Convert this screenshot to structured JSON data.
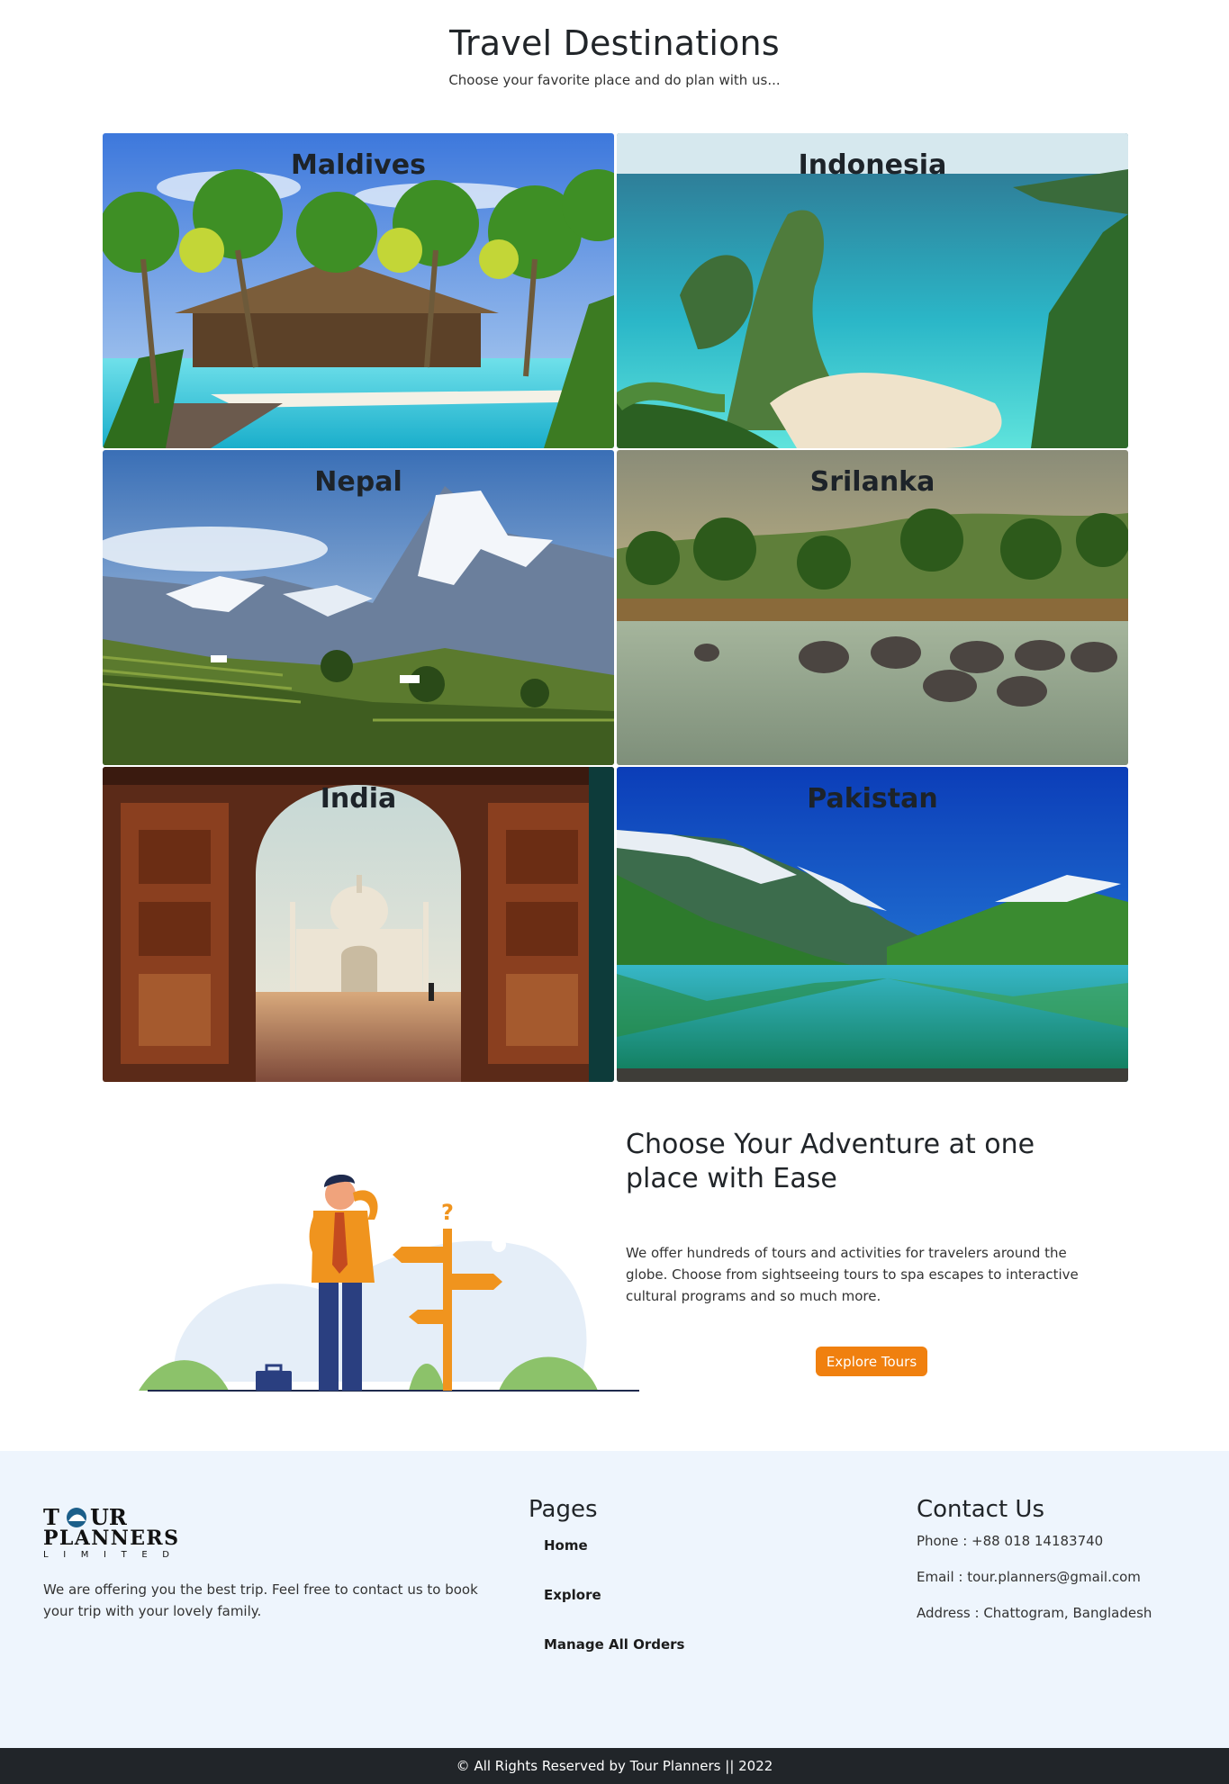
{
  "header": {
    "title": "Travel Destinations",
    "subtitle": "Choose your favorite place and do plan with us..."
  },
  "destinations": [
    {
      "name": "Maldives"
    },
    {
      "name": "Indonesia"
    },
    {
      "name": "Nepal"
    },
    {
      "name": "Srilanka"
    },
    {
      "name": "India"
    },
    {
      "name": "Pakistan"
    }
  ],
  "adventure": {
    "title": "Choose Your Adventure at one place with Ease",
    "description": "We offer hundreds of tours and activities for travelers around the globe. Choose from sightseeing tours to spa escapes to interactive cultural programs and so much more.",
    "button_label": "Explore Tours"
  },
  "footer": {
    "logo": {
      "line1": "T UR",
      "line2": "PLANNERS",
      "line3": "L I M I T E D"
    },
    "about": "We are offering you the best trip. Feel free to contact us to book your trip with your lovely family.",
    "pages_title": "Pages",
    "pages": [
      "Home",
      "Explore",
      "Manage All Orders"
    ],
    "contact_title": "Contact Us",
    "phone": "Phone : +88 018 14183740",
    "email": "Email : tour.planners@gmail.com",
    "address": "Address : Chattogram, Bangladesh"
  },
  "copyright": "© All Rights Reserved by Tour Planners || 2022",
  "colors": {
    "accent": "#f0800f",
    "footer_bg": "#eef5fd",
    "bottom_bar": "#212529"
  }
}
